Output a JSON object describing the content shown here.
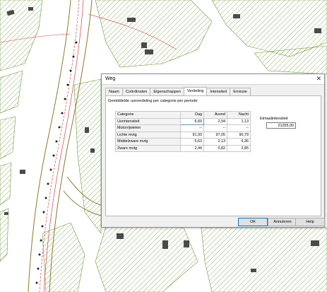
{
  "dialog": {
    "title": "Weg",
    "close_glyph": "✕",
    "tabs": [
      {
        "label": "Naam",
        "active": false
      },
      {
        "label": "Coördinaten",
        "active": false
      },
      {
        "label": "Eigenschappen",
        "active": false
      },
      {
        "label": "Verdeling",
        "active": true
      },
      {
        "label": "Intensiteit",
        "active": false
      },
      {
        "label": "Emissie",
        "active": false
      }
    ],
    "subtitle": "Gemiddelde uurverdeling per categorie per periode",
    "grid": {
      "headers": [
        "Categorie",
        "Dag",
        "Avond",
        "Nacht"
      ],
      "rows": [
        {
          "label": "Uurintensiteit",
          "dag": "6,60",
          "avond": "2,94",
          "nacht": "1,13"
        },
        {
          "label": "Motorrijwielen",
          "dag": "--",
          "avond": "--",
          "nacht": "--"
        },
        {
          "label": "Lichte mvtg",
          "dag": "91,93",
          "avond": "97,05",
          "nacht": "90,79"
        },
        {
          "label": "Middelzware mvtg",
          "dag": "5,63",
          "avond": "2,13",
          "nacht": "6,36"
        },
        {
          "label": "Zware mvtg",
          "dag": "2,44",
          "avond": "0,82",
          "nacht": "2,85"
        }
      ]
    },
    "etmaal": {
      "label": "Etmaalintensiteit",
      "value": "21255,00"
    },
    "buttons": {
      "ok": "OK",
      "cancel": "Annuleren",
      "help": "Help"
    }
  },
  "map": {
    "colors": {
      "hatch": "#6f9a3d",
      "road_outline": "#8a7a2e",
      "red_line": "#d94040",
      "building": "#4a4a4a",
      "marker": "#222222"
    }
  }
}
